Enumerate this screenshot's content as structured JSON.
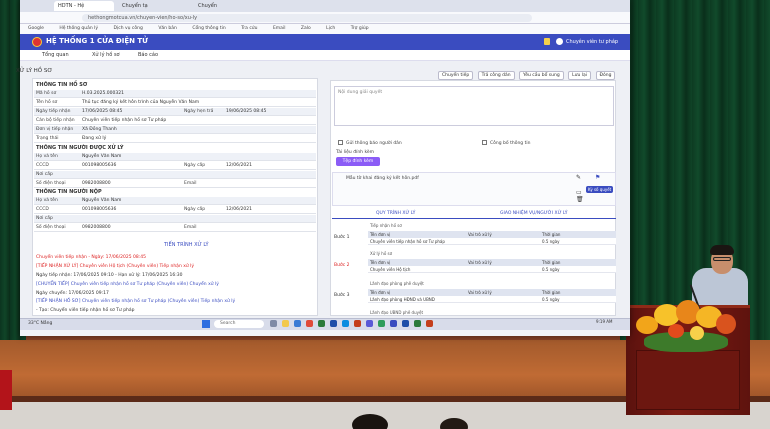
{
  "browser": {
    "tabs": [
      "HDTN - Hệ",
      "Chuyển tạ",
      "Chuyển"
    ],
    "address": "hethongmotcua.vn/chuyen-vien/ho-so/xu-ly",
    "bookmarks": [
      "Google",
      "Hệ thống quản lý",
      "Dịch vụ công",
      "Văn bản",
      "Cổng thông tin",
      "Tra cứu",
      "Email",
      "Zalo",
      "Lịch",
      "Trợ giúp"
    ]
  },
  "app": {
    "title": "HỆ THỐNG 1 CỬA ĐIỆN TỬ",
    "user": "Chuyên viên tư pháp",
    "notif_count": "1"
  },
  "menu": [
    "Tổng quan",
    "Xử lý hồ sơ",
    "Báo cáo"
  ],
  "panel": {
    "title": "XỬ LÝ HỒ SƠ",
    "actions": [
      "Chuyển tiếp",
      "Trả công dân",
      "Yêu cầu bổ sung",
      "Lưu lại",
      "Đóng"
    ]
  },
  "dossier": {
    "section1": "THÔNG TIN HỒ SƠ",
    "rows1": [
      {
        "label": "Mã hồ sơ",
        "value": "H.03.2025.000321"
      },
      {
        "label": "Tên hồ sơ",
        "value": "Thủ tục đăng ký kết hôn trình của Nguyễn Văn Nam"
      },
      {
        "label": "Ngày tiếp nhận",
        "value": "17/06/2025 08:45",
        "label2": "Ngày hẹn trả",
        "value2": "19/06/2025 08:45"
      },
      {
        "label": "Cán bộ tiếp nhận",
        "value": "Chuyên viên tiếp nhận hồ sơ Tư pháp"
      },
      {
        "label": "Đơn vị tiếp nhận",
        "value": "Xã Đồng Thanh"
      },
      {
        "label": "Trạng thái",
        "value": "Đang xử lý"
      }
    ],
    "section2": "THÔNG TIN NGƯỜI ĐƯỢC XỬ LÝ",
    "rows2": [
      {
        "label": "Họ và tên",
        "value": "Nguyễn Văn Nam"
      },
      {
        "label": "CCCD",
        "value": "001098005636",
        "label2": "Ngày cấp",
        "value2": "12/06/2021"
      },
      {
        "label": "Nơi cấp",
        "value": ""
      },
      {
        "label": "Số điện thoại",
        "value": "0982008800",
        "label2": "Email",
        "value2": ""
      }
    ],
    "section3": "THÔNG TIN NGƯỜI NỘP",
    "rows3": [
      {
        "label": "Họ và tên",
        "value": "Nguyễn Văn Nam"
      },
      {
        "label": "CCCD",
        "value": "001098005636",
        "label2": "Ngày cấp",
        "value2": "12/06/2021"
      },
      {
        "label": "Nơi cấp",
        "value": ""
      },
      {
        "label": "Số điện thoại",
        "value": "0982008800",
        "label2": "Email",
        "value2": ""
      }
    ],
    "history_title": "TIẾN TRÌNH XỬ LÝ",
    "history": [
      {
        "text": "Chuyển viên tiếp nhận - Ngày: 17/06/2025 08:45",
        "cls": "hl-red"
      },
      {
        "text": "[TIẾP NHẬN XỬ LÝ] Chuyên viên Hộ tịch (Chuyên viên) Tiếp nhận xử lý",
        "cls": "hl-red"
      },
      {
        "text": "Ngày tiếp nhận: 17/06/2025 09:10 - Hạn xử lý: 17/06/2025 16:30",
        "cls": ""
      },
      {
        "text": "[CHUYỂN TIẾP] Chuyên viên tiếp nhận hồ sơ Tư pháp (Chuyên viên) Chuyển xử lý",
        "cls": "hl-blue"
      },
      {
        "text": "Ngày chuyển: 17/06/2025 09:17",
        "cls": ""
      },
      {
        "text": "[TIẾP NHẬN HỒ SƠ] Chuyên viên tiếp nhận hồ sơ Tư pháp (Chuyên viên) Tiếp nhận xử lý",
        "cls": "hl-blue"
      },
      {
        "text": "- Tạo: Chuyển viên tiếp nhận hồ sơ Tư pháp",
        "cls": ""
      }
    ]
  },
  "form": {
    "opinion_placeholder": "Nội dung giải quyết",
    "check1": "Gửi thông báo người dân",
    "check2": "Công bố thông tin",
    "attach_label": "Tài liệu đính kèm",
    "attach_button": "Tệp đính kèm",
    "comment": "Mẫu tờ khai đăng ký kết hôn.pdf",
    "tooltip": "Ký số quyết",
    "tab1": "QUY TRÌNH XỬ LÝ",
    "tab2": "GIAO NHIỆM VỤ/NGƯỜI XỬ LÝ"
  },
  "steps": [
    {
      "label": "Bước 1",
      "red": false,
      "sub": "Tiếp nhận hồ sơ",
      "cols": [
        "Tên đơn vị",
        "Vai trò xử lý",
        "Thời gian"
      ],
      "row": [
        "Chuyên viên tiếp nhận hồ sơ Tư pháp",
        "",
        "0.5 ngày"
      ]
    },
    {
      "label": "Bước 2",
      "red": true,
      "sub": "Xử lý hồ sơ",
      "cols": [
        "Tên đơn vị",
        "Vai trò xử lý",
        "Thời gian"
      ],
      "row": [
        "Chuyên viên Hộ tịch",
        "",
        "0.5 ngày"
      ]
    },
    {
      "label": "Bước 3",
      "red": false,
      "sub": "Lãnh đạo phòng phê duyệt",
      "cols": [
        "Tên đơn vị",
        "Vai trò xử lý",
        "Thời gian"
      ],
      "row": [
        "Lãnh đạo phòng HĐND và UBND",
        "",
        "0.5 ngày"
      ]
    }
  ],
  "step4_sub": "Lãnh đạo UBND phê duyệt",
  "taskbar": {
    "search": "Search",
    "weather": "33°C Nắng",
    "clock": "9:19 AM"
  }
}
